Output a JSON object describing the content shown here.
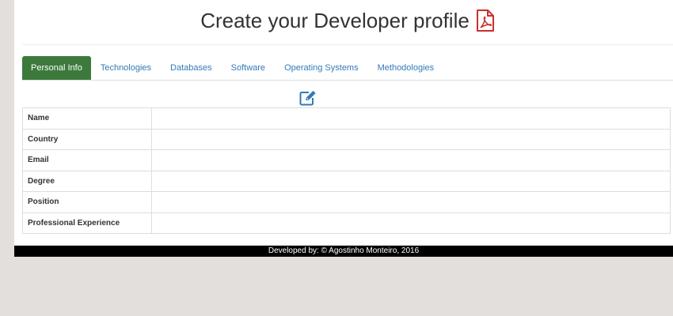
{
  "header": {
    "title": "Create your Developer profile",
    "pdf_icon": "pdf-file-icon",
    "pdf_icon_color": "#c9302c"
  },
  "tabs": [
    {
      "label": "Personal Info",
      "active": true
    },
    {
      "label": "Technologies",
      "active": false
    },
    {
      "label": "Databases",
      "active": false
    },
    {
      "label": "Software",
      "active": false
    },
    {
      "label": "Operating Systems",
      "active": false
    },
    {
      "label": "Methodologies",
      "active": false
    }
  ],
  "edit_icon": "edit-icon",
  "profile": {
    "rows": [
      {
        "label": "Name",
        "value": ""
      },
      {
        "label": "Country",
        "value": ""
      },
      {
        "label": "Email",
        "value": ""
      },
      {
        "label": "Degree",
        "value": ""
      },
      {
        "label": "Position",
        "value": ""
      },
      {
        "label": "Professional Experience",
        "value": ""
      }
    ]
  },
  "footer": {
    "text": "Developed by: © Agostinho Monteiro, 2016"
  },
  "colors": {
    "active_tab": "#3c7a3c",
    "link": "#337ab7",
    "background": "#e3dfdd",
    "footer_bg": "#000000"
  }
}
